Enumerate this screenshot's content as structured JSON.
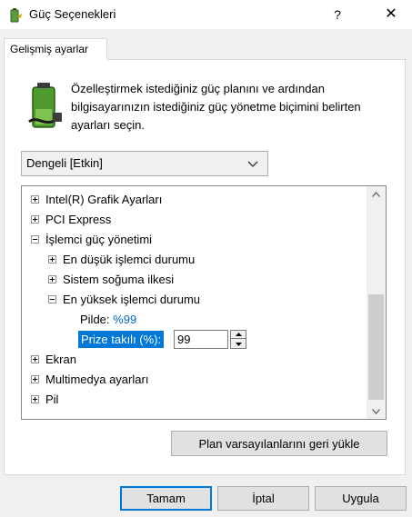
{
  "window": {
    "title": "Güç Seçenekleri",
    "help_label": "?",
    "close_label": "✕"
  },
  "tab": {
    "label": "Gelişmiş ayarlar"
  },
  "description": "Özelleştirmek istediğiniz güç planını ve ardından bilgisayarınızın istediğiniz güç yönetme biçimini belirten ayarları seçin.",
  "plan_select": {
    "value": "Dengeli [Etkin]"
  },
  "tree": {
    "items": [
      {
        "label": "Intel(R) Grafik Ayarları",
        "state": "collapsed"
      },
      {
        "label": "PCI Express",
        "state": "collapsed"
      },
      {
        "label": "İşlemci güç yönetimi",
        "state": "expanded"
      },
      {
        "label": "En düşük işlemci durumu",
        "state": "collapsed"
      },
      {
        "label": "Sistem soğuma ilkesi",
        "state": "collapsed"
      },
      {
        "label": "En yüksek işlemci durumu",
        "state": "expanded"
      },
      {
        "label": "Pilde:",
        "value": "%99"
      },
      {
        "label": "Prize takılı (%):",
        "value": "99"
      },
      {
        "label": "Ekran",
        "state": "collapsed"
      },
      {
        "label": "Multimedya ayarları",
        "state": "collapsed"
      },
      {
        "label": "Pil",
        "state": "collapsed"
      }
    ]
  },
  "buttons": {
    "restore": "Plan varsayılanlarını geri yükle",
    "ok": "Tamam",
    "cancel": "İptal",
    "apply": "Uygula"
  },
  "colors": {
    "accent": "#0078d7",
    "link": "#0066cc",
    "window_bg": "#f0f0f0"
  },
  "icons": [
    "power-options-icon",
    "battery-plug-icon",
    "chevron-down-icon",
    "scroll-up-icon",
    "scroll-down-icon"
  ]
}
